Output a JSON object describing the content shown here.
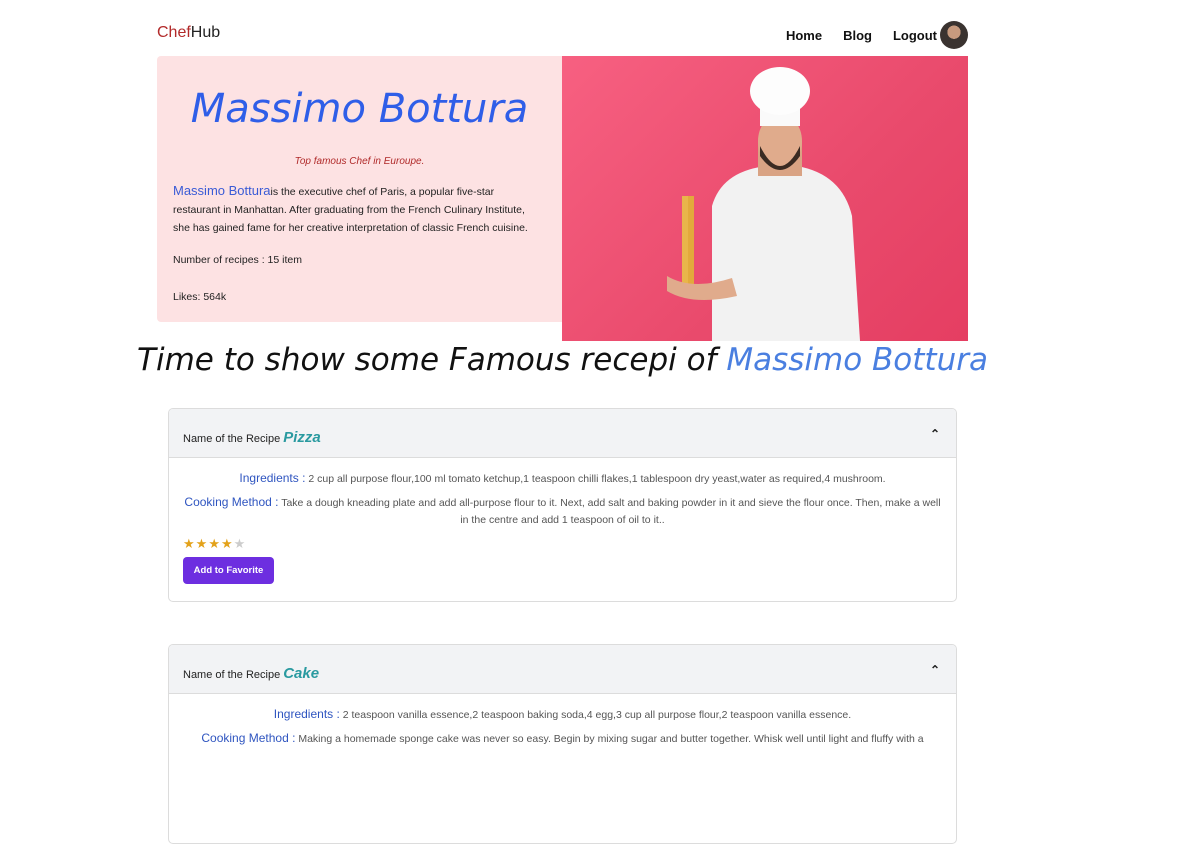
{
  "nav": {
    "logo_part1": "Chef",
    "logo_part2": "Hub",
    "links": [
      "Home",
      "Blog",
      "Logout"
    ]
  },
  "hero": {
    "name": "Massimo Bottura",
    "tagline": "Top famous Chef in Euroupe.",
    "bio_name": "Massimo Bottura",
    "bio": "is the executive chef of Paris, a popular five-star restaurant in Manhattan. After graduating from the French Culinary Institute, she has gained fame for her creative interpretation of classic French cuisine.",
    "recipes": "Number of recipes : 15 item",
    "likes": "Likes: 564k",
    "bg_color": "#e94a6c"
  },
  "headline": {
    "text": "Time to show some Famous recepi of ",
    "highlight": "Massimo Bottura"
  },
  "recipes": [
    {
      "label": "Name of the Recipe",
      "name": "Pizza",
      "ingredients_label": "Ingredients :",
      "ingredients": " 2 cup all purpose flour,100 ml tomato ketchup,1 teaspoon chilli flakes,1 tablespoon dry yeast,water as required,4 mushroom.",
      "method_label": "Cooking Method :",
      "method": " Take a dough kneading plate and add all-purpose flour to it. Next, add salt and baking powder in it and sieve the flour once. Then, make a well in the centre and add 1 teaspoon of oil to it..",
      "rating": 4,
      "max_rating": 5,
      "button": "Add to Favorite"
    },
    {
      "label": "Name of the Recipe",
      "name": "Cake",
      "ingredients_label": "Ingredients :",
      "ingredients": " 2 teaspoon vanilla essence,2 teaspoon baking soda,4 egg,3 cup all purpose flour,2 teaspoon vanilla essence.",
      "method_label": "Cooking Method :",
      "method": " Making a homemade sponge cake was never so easy. Begin by mixing sugar and butter together. Whisk well until light and fluffy with a"
    }
  ]
}
